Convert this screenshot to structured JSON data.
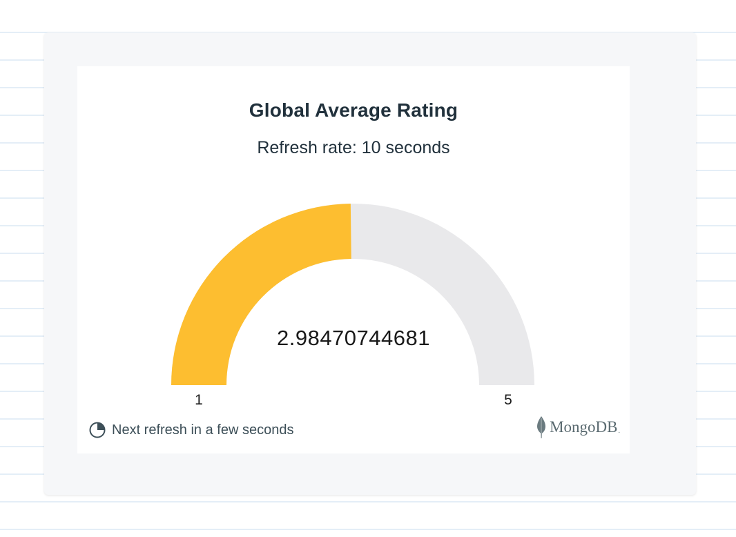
{
  "colors": {
    "gauge_fill": "#fdbe30",
    "gauge_track": "#e9e9eb",
    "title_text": "#21313c",
    "outer_card": "#f6f7f9"
  },
  "chart_data": {
    "type": "gauge",
    "title": "Global Average Rating",
    "subtitle": "Refresh rate: 10 seconds",
    "value": 2.98470744681,
    "value_label": "2.98470744681",
    "min": 1,
    "max": 5,
    "min_label": "1",
    "max_label": "5"
  },
  "footer": {
    "refresh_text": "Next refresh in a few seconds",
    "refresh_icon": "clock-pie-icon",
    "brand_text": "MongoDB",
    "brand_suffix": ".",
    "brand_icon": "mongodb-leaf-icon"
  }
}
